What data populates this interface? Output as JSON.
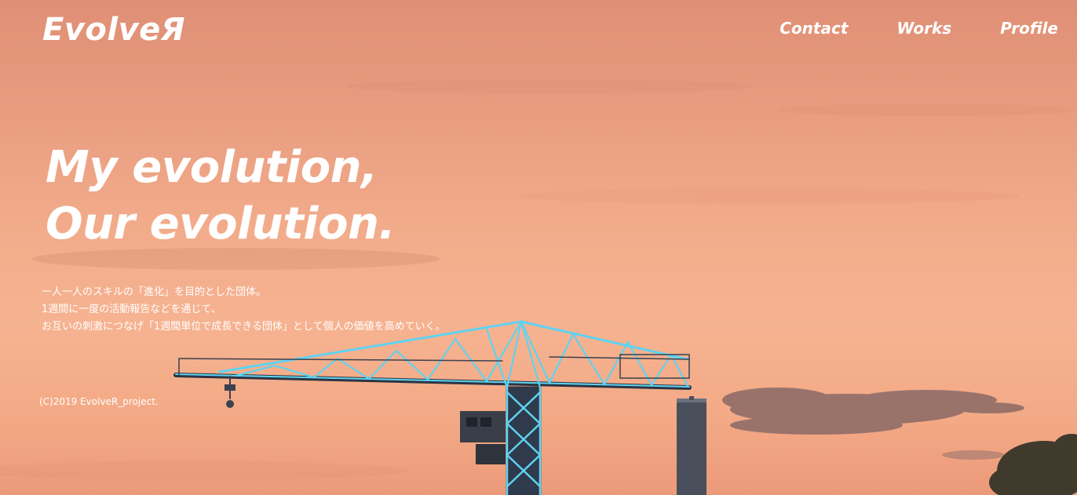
{
  "brand": {
    "logo": "EvolveЯ"
  },
  "nav": {
    "items": [
      "Contact",
      "Works",
      "Profile"
    ]
  },
  "hero": {
    "headline": [
      "My evolution,",
      "Our evolution."
    ],
    "description": [
      "一人一人のスキルの「進化」を目的とした団体。",
      "1週間に一度の活動報告などを通じて、",
      "お互いの刺激につなげ「1週間単位で成長できる団体」として個人の価値を高めていく。"
    ],
    "background_colors": {
      "sky_top": "#df8f75",
      "sky_mid": "#f2ab8a",
      "crane_light": "#5fd3f0"
    }
  },
  "footer": {
    "copyright": "(C)2019 EvolveR_project."
  }
}
